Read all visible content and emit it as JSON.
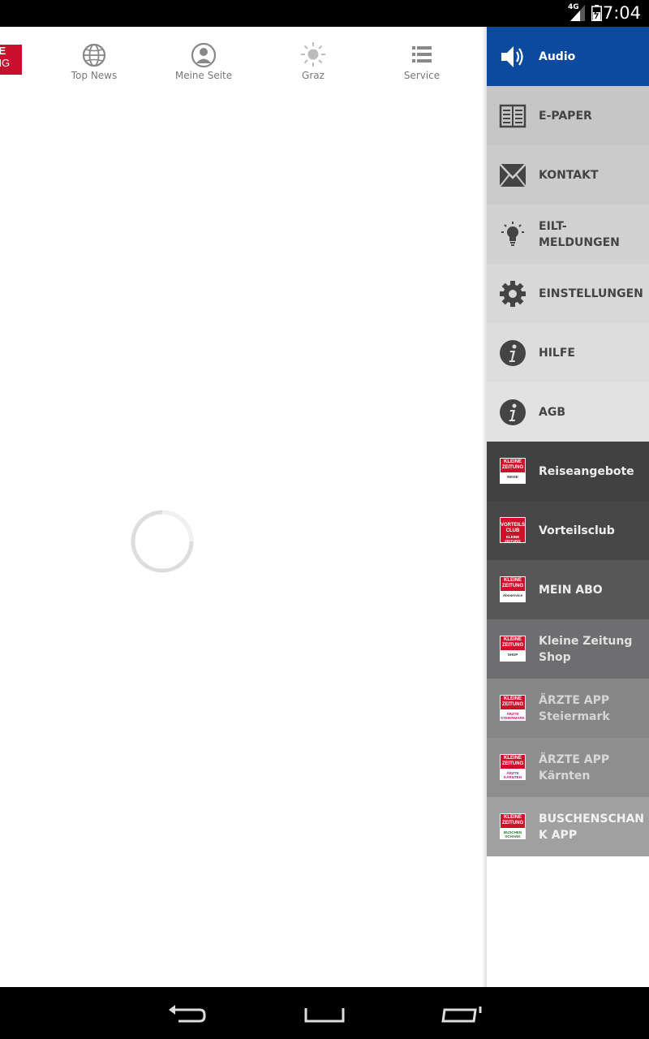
{
  "status_bar": {
    "time": "7:04",
    "network": "4G"
  },
  "top_nav": {
    "logo_lines": [
      "NE",
      "ING"
    ],
    "items": [
      {
        "label": "Top News",
        "icon": "globe-icon"
      },
      {
        "label": "Meine Seite",
        "icon": "user-icon"
      },
      {
        "label": "Graz",
        "icon": "sun-icon"
      },
      {
        "label": "Service",
        "icon": "list-icon"
      }
    ]
  },
  "drawer": {
    "items": [
      {
        "label": "Audio",
        "icon": "speaker-icon"
      },
      {
        "label": "E-PAPER",
        "icon": "newspaper-icon"
      },
      {
        "label": "KONTAKT",
        "icon": "mail-icon"
      },
      {
        "label": "EILT-\nMELDUNGEN",
        "icon": "lightbulb-icon"
      },
      {
        "label": "EINSTELLUNGEN",
        "icon": "gear-icon"
      },
      {
        "label": "HILFE",
        "icon": "info-icon"
      },
      {
        "label": "AGB",
        "icon": "info-icon"
      },
      {
        "label": "Reiseangebote",
        "icon": "kleine-zeitung-reise-logo",
        "badge_top": "KLEINE ZEITUNG",
        "badge_sub": "REISE"
      },
      {
        "label": "Vorteilsclub",
        "icon": "vorteilsclub-logo",
        "badge_top": "VORTEILS CLUB",
        "badge_sub": "KLEINE ZEITUNG"
      },
      {
        "label": "MEIN ABO",
        "icon": "kleine-zeitung-aboservice-logo",
        "badge_top": "KLEINE ZEITUNG",
        "badge_sub": "Aboservice"
      },
      {
        "label": "Kleine Zeitung Shop",
        "icon": "kleine-zeitung-shop-logo",
        "badge_top": "KLEINE ZEITUNG",
        "badge_sub": "SHOP"
      },
      {
        "label": "ÄRZTE APP Steiermark",
        "icon": "aerzte-steiermark-logo",
        "badge_top": "KLEINE ZEITUNG",
        "badge_sub": "ÄRZTE STEIERMARK"
      },
      {
        "label": "ÄRZTE APP Kärnten",
        "icon": "aerzte-kaernten-logo",
        "badge_top": "KLEINE ZEITUNG",
        "badge_sub": "ÄRZTE KÄRNTEN"
      },
      {
        "label": "BUSCHENSCHAN K APP",
        "icon": "buschenschank-logo",
        "badge_top": "KLEINE ZEITUNG",
        "badge_sub": "BUSCHEN SCHANK"
      }
    ]
  },
  "colors": {
    "accent_blue": "#0b4a9c",
    "brand_red": "#c8102e"
  }
}
